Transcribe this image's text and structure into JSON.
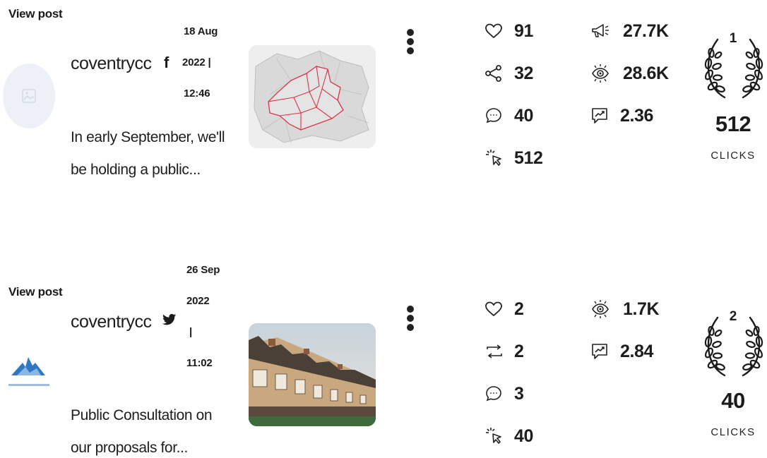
{
  "posts": [
    {
      "view_post": "View post",
      "username": "coventrycc",
      "network": "facebook",
      "network_glyph": "f",
      "date_lines": [
        "18 Aug",
        "2022 |",
        "12:46"
      ],
      "caption_lines": [
        "In early September, we'll",
        "be holding a public..."
      ],
      "thumbnail": "map-image",
      "metrics": [
        {
          "icon": "heart-icon",
          "value": "91"
        },
        {
          "icon": "share-icon",
          "value": "32"
        },
        {
          "icon": "comment-icon",
          "value": "40"
        },
        {
          "icon": "click-icon",
          "value": "512"
        },
        {
          "icon": "megaphone-icon",
          "value": "27.7K"
        },
        {
          "icon": "eye-icon",
          "value": "28.6K"
        },
        {
          "icon": "engagement-chart-icon",
          "value": "2.36"
        }
      ],
      "award": {
        "rank": "1",
        "count": "512",
        "label": "CLICKS"
      }
    },
    {
      "view_post": "View post",
      "username": "coventrycc",
      "network": "twitter",
      "network_glyph": "🐦",
      "date_lines": [
        "26 Sep",
        "2022",
        "|",
        "11:02"
      ],
      "caption_lines": [
        "Public Consultation on",
        "our proposals for..."
      ],
      "thumbnail": "houses-image",
      "metrics": [
        {
          "icon": "heart-icon",
          "value": "2"
        },
        {
          "icon": "retweet-icon",
          "value": "2"
        },
        {
          "icon": "comment-icon",
          "value": "3"
        },
        {
          "icon": "click-icon",
          "value": "40"
        },
        {
          "icon": "eye-icon",
          "value": "1.7K"
        },
        {
          "icon": "engagement-chart-icon",
          "value": "2.84"
        }
      ],
      "award": {
        "rank": "2",
        "count": "40",
        "label": "CLICKS"
      }
    }
  ],
  "colors": {
    "text": "#1d1d1d",
    "avatar_bg": "#edf0f6",
    "map_line": "#d9364a"
  }
}
